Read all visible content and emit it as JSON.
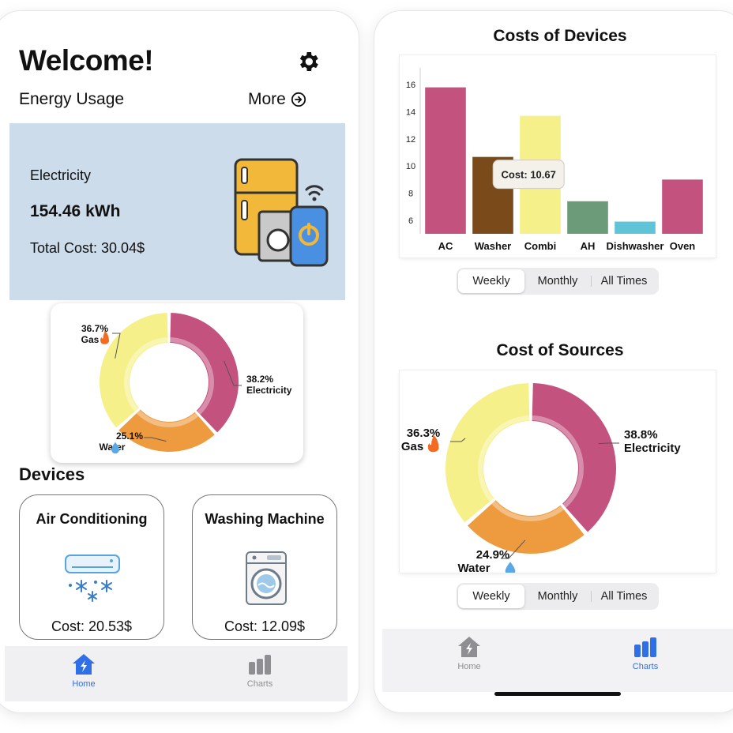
{
  "left": {
    "welcome": "Welcome!",
    "energy_label": "Energy Usage",
    "more_label": "More",
    "electricity_card": {
      "title": "Electricity",
      "value": "154.46 kWh",
      "total_cost": "Total Cost: 30.04$"
    },
    "usage_donut": [
      {
        "label": "Electricity",
        "pct": "38.2%",
        "value": 38.2,
        "color": "#c4527f"
      },
      {
        "label": "Water",
        "pct": "25.1%",
        "value": 25.1,
        "color": "#ee9a3e"
      },
      {
        "label": "Gas",
        "pct": "36.7%",
        "value": 36.7,
        "color": "#f6f08a"
      }
    ],
    "devices_heading": "Devices",
    "devices": [
      {
        "name": "Air Conditioning",
        "cost": "Cost: 20.53$"
      },
      {
        "name": "Washing Machine",
        "cost": "Cost: 12.09$"
      }
    ],
    "tabs": [
      {
        "label": "Home",
        "active": true
      },
      {
        "label": "Charts",
        "active": false
      }
    ]
  },
  "right": {
    "costs_title": "Costs of Devices",
    "sources_title": "Cost of Sources",
    "period_options": [
      "Weekly",
      "Monthly",
      "All Times"
    ],
    "selected_period": "Weekly",
    "tooltip": "Cost: 10.67",
    "sources_donut": [
      {
        "label": "Electricity",
        "pct": "38.8%",
        "value": 38.8,
        "color": "#c4527f"
      },
      {
        "label": "Water",
        "pct": "24.9%",
        "value": 24.9,
        "color": "#ee9a3e"
      },
      {
        "label": "Gas",
        "pct": "36.3%",
        "value": 36.3,
        "color": "#f6f08a"
      }
    ],
    "tabs": [
      {
        "label": "Home",
        "active": false
      },
      {
        "label": "Charts",
        "active": true
      }
    ]
  },
  "chart_data": {
    "type": "bar",
    "title": "Costs of Devices",
    "categories": [
      "AC",
      "Washer",
      "Combi",
      "AH",
      "Dishwasher",
      "Oven"
    ],
    "values": [
      15.8,
      10.67,
      13.7,
      7.4,
      5.9,
      9.0
    ],
    "colors": [
      "#c4527f",
      "#7a4a1a",
      "#f6f08a",
      "#6b9b78",
      "#5fc4d8",
      "#c4527f"
    ],
    "yticks": [
      6,
      8,
      10,
      12,
      14,
      16
    ],
    "ylim": [
      5,
      17
    ],
    "xlabel": "",
    "ylabel": "",
    "grid": false
  }
}
